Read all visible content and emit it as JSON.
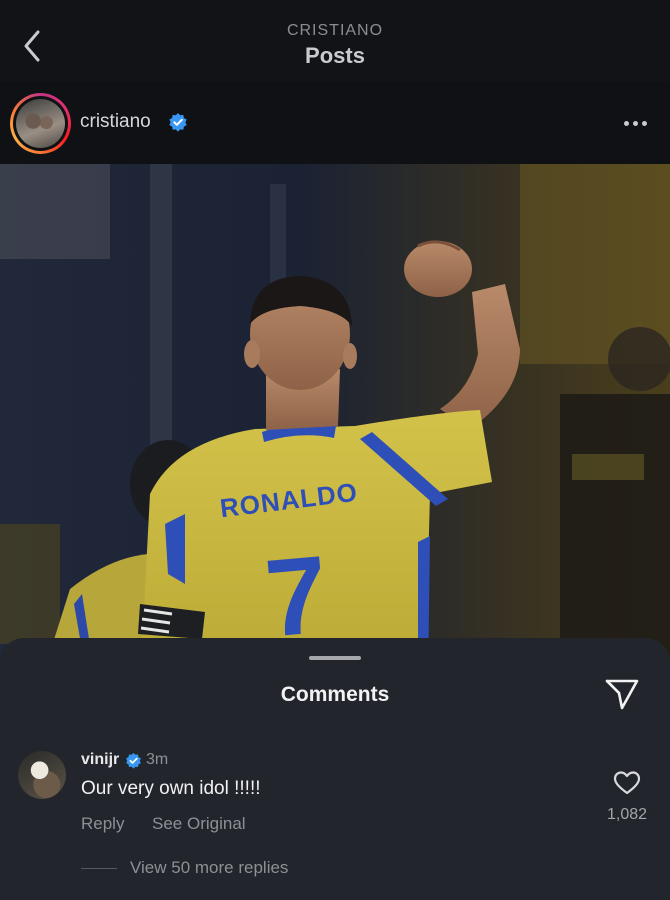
{
  "header": {
    "account": "CRISTIANO",
    "title": "Posts"
  },
  "post": {
    "username": "cristiano",
    "verified": true,
    "jersey_name": "RONALDO",
    "jersey_number": "7"
  },
  "comments_sheet": {
    "title": "Comments",
    "comments": [
      {
        "username": "vinijr",
        "verified": true,
        "time": "3m",
        "text": "Our very own idol !!!!!",
        "reply_label": "Reply",
        "see_original_label": "See Original",
        "likes": "1,082",
        "more_replies_label": "View 50 more replies"
      }
    ]
  },
  "colors": {
    "background": "#0c0e12",
    "sheet": "#22252b",
    "verified_blue": "#3897f0",
    "jersey_yellow": "#c9b43a",
    "jersey_blue": "#2f4fb8"
  },
  "icons": [
    "chevron-left-icon",
    "verified-icon",
    "more-dots-icon",
    "send-icon",
    "heart-icon"
  ]
}
